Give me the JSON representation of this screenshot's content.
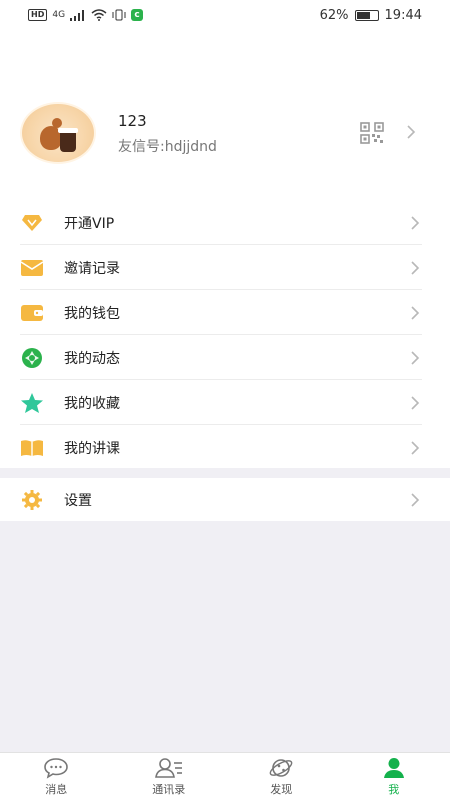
{
  "status_bar": {
    "left_badge": "HD",
    "network": "4G",
    "battery_percent": "62%",
    "time": "19:44"
  },
  "profile": {
    "name": "123",
    "wechat_id": "友信号:hdjjdnd"
  },
  "menu_group_1": [
    {
      "label": "开通VIP",
      "icon": "vip-diamond-icon",
      "color": "#f5b841"
    },
    {
      "label": "邀请记录",
      "icon": "envelope-icon",
      "color": "#f5b841"
    },
    {
      "label": "我的钱包",
      "icon": "wallet-icon",
      "color": "#f5b841"
    },
    {
      "label": "我的动态",
      "icon": "aperture-icon",
      "color": "#2bb24c"
    },
    {
      "label": "我的收藏",
      "icon": "star-icon",
      "color": "#2fc79a"
    },
    {
      "label": "我的讲课",
      "icon": "book-icon",
      "color": "#f5b841"
    }
  ],
  "menu_group_2": [
    {
      "label": "设置",
      "icon": "settings-gear-icon",
      "color": "#f5b841"
    }
  ],
  "tabbar": [
    {
      "label": "消息",
      "icon": "chat-bubble-icon",
      "active": false
    },
    {
      "label": "通讯录",
      "icon": "contacts-icon",
      "active": false
    },
    {
      "label": "发现",
      "icon": "planet-icon",
      "active": false
    },
    {
      "label": "我",
      "icon": "person-icon",
      "active": true
    }
  ],
  "colors": {
    "accent": "#14b14c",
    "background": "#f0eff4",
    "chevron": "#b8b8b8"
  }
}
